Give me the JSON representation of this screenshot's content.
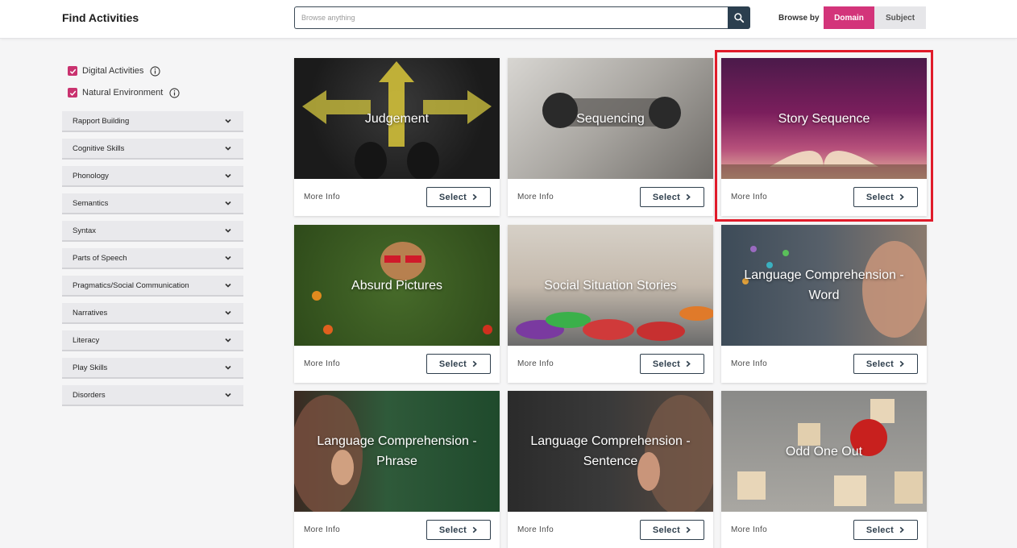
{
  "header": {
    "title": "Find Activities",
    "search_placeholder": "Browse anything",
    "browse_by_label": "Browse by",
    "browse_options": [
      "Domain",
      "Subject"
    ],
    "active_option": "Domain"
  },
  "filters": [
    {
      "label": "Digital Activities",
      "checked": true
    },
    {
      "label": "Natural Environment",
      "checked": true
    }
  ],
  "categories": [
    "Rapport Building",
    "Cognitive Skills",
    "Phonology",
    "Semantics",
    "Syntax",
    "Parts of Speech",
    "Pragmatics/Social Communication",
    "Narratives",
    "Literacy",
    "Play Skills",
    "Disorders"
  ],
  "cards": [
    {
      "title": "Judgement",
      "more_info": "More Info",
      "select": "Select"
    },
    {
      "title": "Sequencing",
      "more_info": "More Info",
      "select": "Select"
    },
    {
      "title": "Story Sequence",
      "more_info": "More Info",
      "select": "Select",
      "highlighted": true
    },
    {
      "title": "Absurd Pictures",
      "more_info": "More Info",
      "select": "Select"
    },
    {
      "title": "Social Situation Stories",
      "more_info": "More Info",
      "select": "Select"
    },
    {
      "title": "Language Comprehension - Word",
      "more_info": "More Info",
      "select": "Select"
    },
    {
      "title": "Language Comprehension - Phrase",
      "more_info": "More Info",
      "select": "Select"
    },
    {
      "title": "Language Comprehension - Sentence",
      "more_info": "More Info",
      "select": "Select"
    },
    {
      "title": "Odd One Out",
      "more_info": "More Info",
      "select": "Select"
    }
  ],
  "colors": {
    "accent": "#d3347a",
    "navy": "#2b3f4f",
    "highlight": "#e01b2a"
  }
}
